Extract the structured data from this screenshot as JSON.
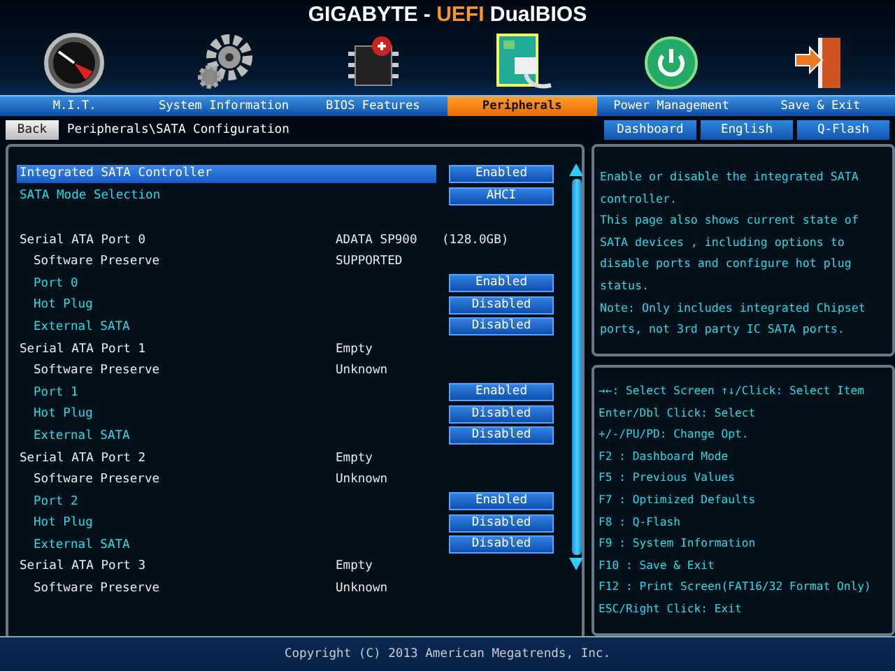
{
  "title": {
    "brand": "GIGABYTE - ",
    "highlight": "UEFI",
    "product": " DualBIOS"
  },
  "tabs": [
    {
      "label": "M.I.T.",
      "selected": false
    },
    {
      "label": "System Information",
      "selected": false
    },
    {
      "label": "BIOS Features",
      "selected": false
    },
    {
      "label": "Peripherals",
      "selected": true
    },
    {
      "label": "Power Management",
      "selected": false
    },
    {
      "label": "Save & Exit",
      "selected": false
    }
  ],
  "back_button": "Back",
  "breadcrumb": "Peripherals\\SATA Configuration",
  "shortcut_buttons": [
    "Dashboard",
    "English",
    "Q-Flash"
  ],
  "settings": [
    {
      "label": "Integrated SATA Controller",
      "value": "Enabled",
      "selected": true
    },
    {
      "label": "SATA Mode Selection",
      "value": "AHCI",
      "selected": false
    }
  ],
  "ports": [
    {
      "label": "Serial ATA Port 0",
      "device": "ADATA SP900",
      "capacity": "(128.0GB)",
      "children": [
        {
          "kind": "info",
          "label": "Software Preserve",
          "value": "SUPPORTED"
        },
        {
          "kind": "option",
          "label": "Port 0",
          "value": "Enabled"
        },
        {
          "kind": "option",
          "label": "Hot Plug",
          "value": "Disabled"
        },
        {
          "kind": "option",
          "label": "External SATA",
          "value": "Disabled"
        }
      ]
    },
    {
      "label": "Serial ATA Port 1",
      "device": "Empty",
      "children": [
        {
          "kind": "info",
          "label": "Software Preserve",
          "value": "Unknown"
        },
        {
          "kind": "option",
          "label": "Port 1",
          "value": "Enabled"
        },
        {
          "kind": "option",
          "label": "Hot Plug",
          "value": "Disabled"
        },
        {
          "kind": "option",
          "label": "External SATA",
          "value": "Disabled"
        }
      ]
    },
    {
      "label": "Serial ATA Port 2",
      "device": "Empty",
      "children": [
        {
          "kind": "info",
          "label": "Software Preserve",
          "value": "Unknown"
        },
        {
          "kind": "option",
          "label": "Port 2",
          "value": "Enabled"
        },
        {
          "kind": "option",
          "label": "Hot Plug",
          "value": "Disabled"
        },
        {
          "kind": "option",
          "label": "External SATA",
          "value": "Disabled"
        }
      ]
    },
    {
      "label": "Serial ATA Port 3",
      "device": "Empty",
      "children": [
        {
          "kind": "info",
          "label": "Software Preserve",
          "value": "Unknown"
        }
      ]
    }
  ],
  "help_lines": [
    "Enable or disable the integrated SATA",
    "controller.",
    "This page also shows current state of",
    "SATA devices , including options to",
    "disable ports and configure hot plug",
    "status.",
    "Note: Only includes integrated Chipset",
    "ports, not 3rd party IC SATA ports."
  ],
  "key_lines": [
    "→←: Select Screen  ↑↓/Click: Select Item",
    "Enter/Dbl Click: Select",
    "+/-/PU/PD: Change Opt.",
    "F2  : Dashboard Mode",
    "F5  : Previous Values",
    "F7  : Optimized Defaults",
    "F8  : Q-Flash",
    "F9  : System Information",
    "F10 : Save & Exit",
    "F12 : Print Screen(FAT16/32 Format Only)",
    "ESC/Right Click: Exit"
  ],
  "footer": "Copyright (C) 2013 American Megatrends, Inc."
}
